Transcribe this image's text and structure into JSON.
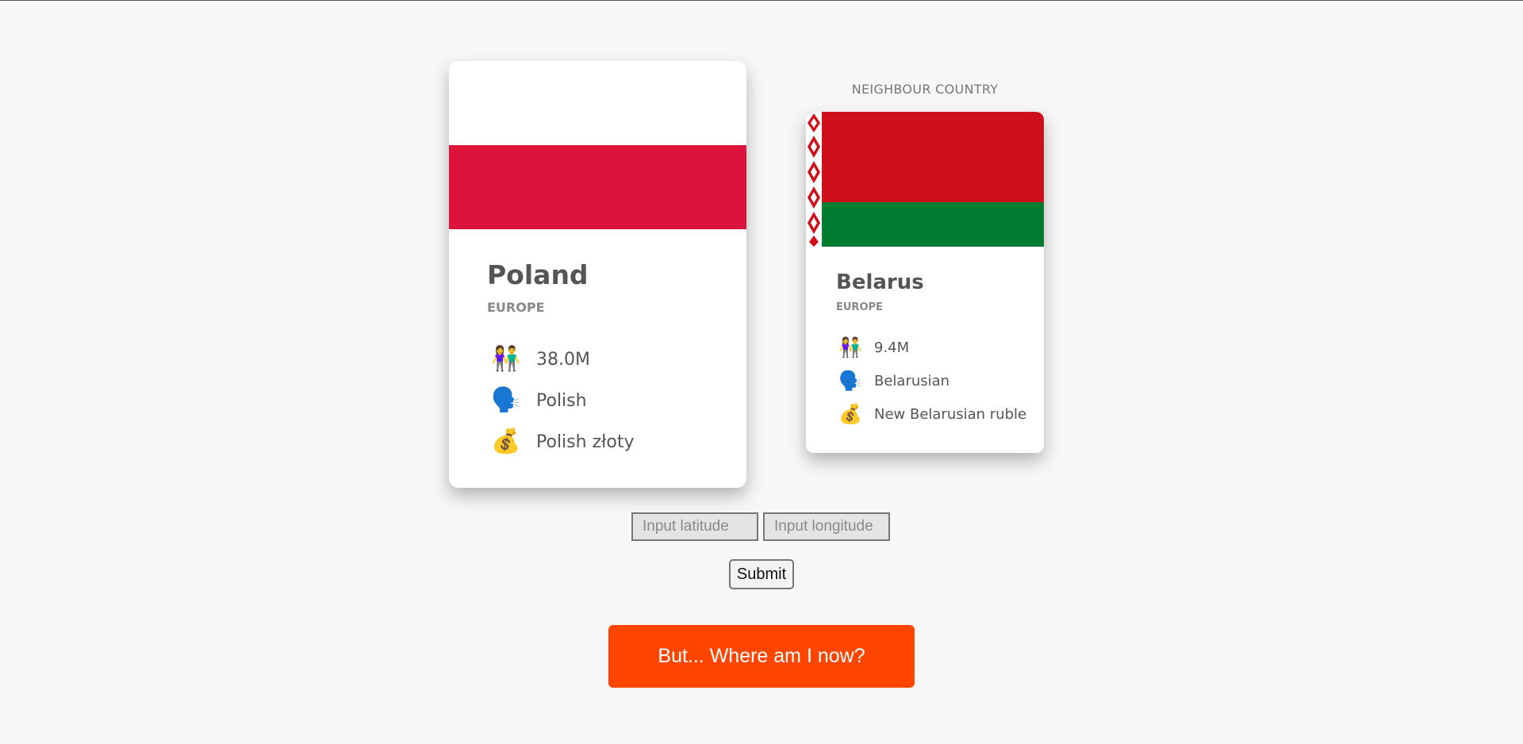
{
  "main_country": {
    "name": "Poland",
    "region": "EUROPE",
    "population": "38.0M",
    "language": "Polish",
    "currency": "Polish złoty",
    "flag_colors": {
      "top": "#ffffff",
      "bottom": "#dc143c"
    }
  },
  "neighbour": {
    "section_label": "NEIGHBOUR COUNTRY",
    "name": "Belarus",
    "region": "EUROPE",
    "population": "9.4M",
    "language": "Belarusian",
    "currency": "New Belarusian ruble",
    "flag_colors": {
      "top": "#cf101a",
      "bottom": "#007c30",
      "ornament": "#cf101a",
      "ornament_bg": "#ffffff"
    }
  },
  "icons": {
    "population": "people-holding-hands-icon",
    "language": "speaking-head-icon",
    "currency": "money-bag-icon"
  },
  "form": {
    "latitude_placeholder": "Input latitude",
    "longitude_placeholder": "Input longitude",
    "latitude_value": "",
    "longitude_value": "",
    "submit_label": "Submit"
  },
  "where_button": {
    "label": "But... Where am I now?",
    "color": "#ff4500"
  }
}
